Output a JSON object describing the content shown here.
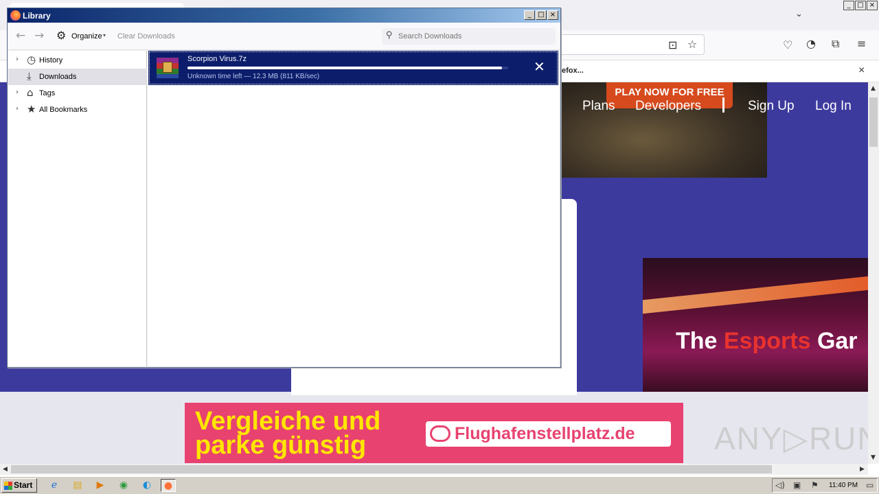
{
  "browser": {
    "tab_list_icon": "chevron-down-icon",
    "window_controls": [
      "_",
      "□",
      "×"
    ],
    "notification": {
      "text": "efox...",
      "close": "×"
    },
    "site": {
      "promo_button": "PLAY NOW FOR FREE",
      "nav": {
        "plans": "Plans",
        "developers": "Developers",
        "sign_up": "Sign Up",
        "log_in": "Log In"
      },
      "esports_title_pre": "The ",
      "esports_title_accent": "Esports",
      "esports_title_post": " Gar"
    },
    "ad": {
      "line1": "Vergleiche und",
      "line2": "parke günstig",
      "cta": "Flughafenstellplatz.de"
    },
    "watermark": "ANY▷RUN"
  },
  "library": {
    "title": "Library",
    "controls": {
      "minimize": "_",
      "maximize": "□",
      "close": "×"
    },
    "toolbar": {
      "organize_label": "Organize",
      "clear_downloads_label": "Clear Downloads",
      "search_placeholder": "Search Downloads"
    },
    "sidebar": {
      "items": [
        {
          "label": "History",
          "icon": "clock-icon",
          "has_twisty": true,
          "selected": false
        },
        {
          "label": "Downloads",
          "icon": "download-icon",
          "has_twisty": false,
          "selected": true
        },
        {
          "label": "Tags",
          "icon": "tag-icon",
          "has_twisty": true,
          "selected": false
        },
        {
          "label": "All Bookmarks",
          "icon": "star-icon",
          "has_twisty": true,
          "selected": false
        }
      ]
    },
    "downloads": [
      {
        "filename": "Scorpion Virus.7z",
        "status": "Unknown time left — 12.3 MB (811 KB/sec)",
        "progress_fraction": 0.98,
        "file_icon": "winrar-archive-icon"
      }
    ]
  },
  "taskbar": {
    "start_label": "Start",
    "apps": [
      "ie-icon",
      "explorer-icon",
      "media-player-icon",
      "chrome-icon",
      "edge-icon",
      "firefox-icon"
    ],
    "clock": "11:40 PM"
  },
  "colors": {
    "site_purple": "#3d3a9e",
    "selection_blue": "#0c1e6b",
    "ad_pink": "#e84270",
    "ad_yellow": "#ffe600",
    "titlebar_blue": "#0a246a"
  }
}
